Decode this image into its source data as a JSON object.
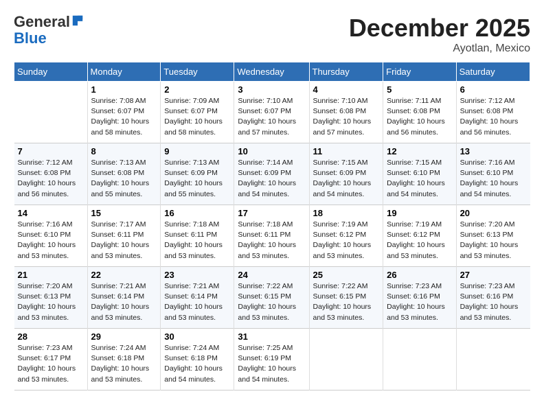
{
  "header": {
    "logo_line1": "General",
    "logo_line2": "Blue",
    "month": "December 2025",
    "location": "Ayotlan, Mexico"
  },
  "days_of_week": [
    "Sunday",
    "Monday",
    "Tuesday",
    "Wednesday",
    "Thursday",
    "Friday",
    "Saturday"
  ],
  "weeks": [
    [
      {
        "day": "",
        "info": ""
      },
      {
        "day": "1",
        "info": "Sunrise: 7:08 AM\nSunset: 6:07 PM\nDaylight: 10 hours\nand 58 minutes."
      },
      {
        "day": "2",
        "info": "Sunrise: 7:09 AM\nSunset: 6:07 PM\nDaylight: 10 hours\nand 58 minutes."
      },
      {
        "day": "3",
        "info": "Sunrise: 7:10 AM\nSunset: 6:07 PM\nDaylight: 10 hours\nand 57 minutes."
      },
      {
        "day": "4",
        "info": "Sunrise: 7:10 AM\nSunset: 6:08 PM\nDaylight: 10 hours\nand 57 minutes."
      },
      {
        "day": "5",
        "info": "Sunrise: 7:11 AM\nSunset: 6:08 PM\nDaylight: 10 hours\nand 56 minutes."
      },
      {
        "day": "6",
        "info": "Sunrise: 7:12 AM\nSunset: 6:08 PM\nDaylight: 10 hours\nand 56 minutes."
      }
    ],
    [
      {
        "day": "7",
        "info": "Sunrise: 7:12 AM\nSunset: 6:08 PM\nDaylight: 10 hours\nand 56 minutes."
      },
      {
        "day": "8",
        "info": "Sunrise: 7:13 AM\nSunset: 6:08 PM\nDaylight: 10 hours\nand 55 minutes."
      },
      {
        "day": "9",
        "info": "Sunrise: 7:13 AM\nSunset: 6:09 PM\nDaylight: 10 hours\nand 55 minutes."
      },
      {
        "day": "10",
        "info": "Sunrise: 7:14 AM\nSunset: 6:09 PM\nDaylight: 10 hours\nand 54 minutes."
      },
      {
        "day": "11",
        "info": "Sunrise: 7:15 AM\nSunset: 6:09 PM\nDaylight: 10 hours\nand 54 minutes."
      },
      {
        "day": "12",
        "info": "Sunrise: 7:15 AM\nSunset: 6:10 PM\nDaylight: 10 hours\nand 54 minutes."
      },
      {
        "day": "13",
        "info": "Sunrise: 7:16 AM\nSunset: 6:10 PM\nDaylight: 10 hours\nand 54 minutes."
      }
    ],
    [
      {
        "day": "14",
        "info": "Sunrise: 7:16 AM\nSunset: 6:10 PM\nDaylight: 10 hours\nand 53 minutes."
      },
      {
        "day": "15",
        "info": "Sunrise: 7:17 AM\nSunset: 6:11 PM\nDaylight: 10 hours\nand 53 minutes."
      },
      {
        "day": "16",
        "info": "Sunrise: 7:18 AM\nSunset: 6:11 PM\nDaylight: 10 hours\nand 53 minutes."
      },
      {
        "day": "17",
        "info": "Sunrise: 7:18 AM\nSunset: 6:11 PM\nDaylight: 10 hours\nand 53 minutes."
      },
      {
        "day": "18",
        "info": "Sunrise: 7:19 AM\nSunset: 6:12 PM\nDaylight: 10 hours\nand 53 minutes."
      },
      {
        "day": "19",
        "info": "Sunrise: 7:19 AM\nSunset: 6:12 PM\nDaylight: 10 hours\nand 53 minutes."
      },
      {
        "day": "20",
        "info": "Sunrise: 7:20 AM\nSunset: 6:13 PM\nDaylight: 10 hours\nand 53 minutes."
      }
    ],
    [
      {
        "day": "21",
        "info": "Sunrise: 7:20 AM\nSunset: 6:13 PM\nDaylight: 10 hours\nand 53 minutes."
      },
      {
        "day": "22",
        "info": "Sunrise: 7:21 AM\nSunset: 6:14 PM\nDaylight: 10 hours\nand 53 minutes."
      },
      {
        "day": "23",
        "info": "Sunrise: 7:21 AM\nSunset: 6:14 PM\nDaylight: 10 hours\nand 53 minutes."
      },
      {
        "day": "24",
        "info": "Sunrise: 7:22 AM\nSunset: 6:15 PM\nDaylight: 10 hours\nand 53 minutes."
      },
      {
        "day": "25",
        "info": "Sunrise: 7:22 AM\nSunset: 6:15 PM\nDaylight: 10 hours\nand 53 minutes."
      },
      {
        "day": "26",
        "info": "Sunrise: 7:23 AM\nSunset: 6:16 PM\nDaylight: 10 hours\nand 53 minutes."
      },
      {
        "day": "27",
        "info": "Sunrise: 7:23 AM\nSunset: 6:16 PM\nDaylight: 10 hours\nand 53 minutes."
      }
    ],
    [
      {
        "day": "28",
        "info": "Sunrise: 7:23 AM\nSunset: 6:17 PM\nDaylight: 10 hours\nand 53 minutes."
      },
      {
        "day": "29",
        "info": "Sunrise: 7:24 AM\nSunset: 6:18 PM\nDaylight: 10 hours\nand 53 minutes."
      },
      {
        "day": "30",
        "info": "Sunrise: 7:24 AM\nSunset: 6:18 PM\nDaylight: 10 hours\nand 54 minutes."
      },
      {
        "day": "31",
        "info": "Sunrise: 7:25 AM\nSunset: 6:19 PM\nDaylight: 10 hours\nand 54 minutes."
      },
      {
        "day": "",
        "info": ""
      },
      {
        "day": "",
        "info": ""
      },
      {
        "day": "",
        "info": ""
      }
    ]
  ]
}
